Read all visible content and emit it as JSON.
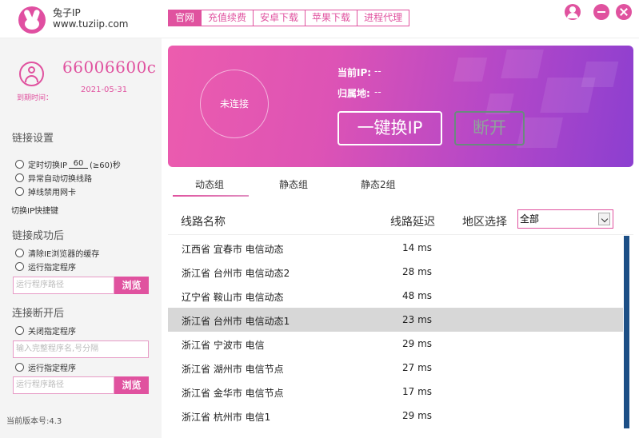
{
  "app": {
    "name": "兔子IP",
    "url": "www.tuziip.com"
  },
  "nav": [
    "官网",
    "充值续费",
    "安卓下载",
    "苹果下载",
    "进程代理"
  ],
  "account": {
    "username": "66006600c",
    "expire_label": "到期时间：",
    "expire_date": "2021-05-31"
  },
  "settings": {
    "link_title": "链接设置",
    "timed_switch_prefix": "定时切换IP",
    "timed_switch_value": "60",
    "timed_switch_suffix": "(≥60)秒",
    "auto_switch": "异常自动切换线路",
    "disable_nic": "掉线禁用网卡",
    "hotkey": "切换IP快捷键",
    "success_title": "链接成功后",
    "clear_ie_cache": "清除IE浏览器的缓存",
    "run_program": "运行指定程序",
    "program_path_placeholder": "运行程序路径",
    "browse_label": "浏览",
    "disconnect_title": "连接断开后",
    "close_program": "关闭指定程序",
    "close_program_placeholder": "输入完整程序名,号分隔",
    "run_program2": "运行指定程序",
    "program_path2_placeholder": "运行程序路径",
    "browse2_label": "浏览"
  },
  "version": "当前版本号:4.3",
  "connection": {
    "status": "未连接",
    "ip_label": "当前IP:",
    "ip_value": "--",
    "location_label": "归属地:",
    "location_value": "--",
    "switch_button": "一键换IP",
    "disconnect_button": "断开"
  },
  "tabs": [
    "动态组",
    "静态组",
    "静态2组"
  ],
  "list": {
    "col_name": "线路名称",
    "col_latency": "线路延迟",
    "region_label": "地区选择",
    "region_value": "全部",
    "rows": [
      {
        "name": "江西省 宜春市 电信动态",
        "latency": "14 ms"
      },
      {
        "name": "浙江省 台州市 电信动态2",
        "latency": "28 ms"
      },
      {
        "name": "辽宁省 鞍山市 电信动态",
        "latency": "48 ms"
      },
      {
        "name": "浙江省 台州市 电信动态1",
        "latency": "23 ms",
        "selected": true
      },
      {
        "name": "浙江省 宁波市 电信",
        "latency": "29 ms"
      },
      {
        "name": "浙江省 湖州市 电信节点",
        "latency": "27 ms"
      },
      {
        "name": "浙江省 金华市 电信节点",
        "latency": "17 ms"
      },
      {
        "name": "浙江省 杭州市 电信1",
        "latency": "29 ms"
      }
    ]
  },
  "colors": {
    "accent": "#e0529f",
    "banner_start": "#ec5cae",
    "banner_end": "#8c3fd0",
    "selected_row": "#d7d7d7",
    "scrollbar": "#1c4f86"
  }
}
